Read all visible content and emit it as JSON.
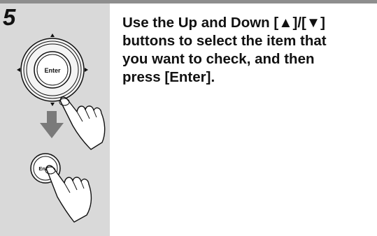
{
  "step": {
    "number": "5"
  },
  "remote": {
    "enter_label": "Enter",
    "small_enter_label": "Enter"
  },
  "instruction": {
    "lines": [
      "Use the Up and Down [▲]/[▼]",
      "buttons to select the item that",
      "you want to check, and then",
      "press [Enter]."
    ]
  },
  "colors": {
    "panel_background": "#d9d9d9",
    "top_rule": "#8e8e8e",
    "arrow_gray": "#7a7a7a",
    "text": "#111111"
  },
  "icons": [
    "directional-pad-icon",
    "enter-button-icon",
    "pressing-hand-icon",
    "down-arrow-icon"
  ]
}
